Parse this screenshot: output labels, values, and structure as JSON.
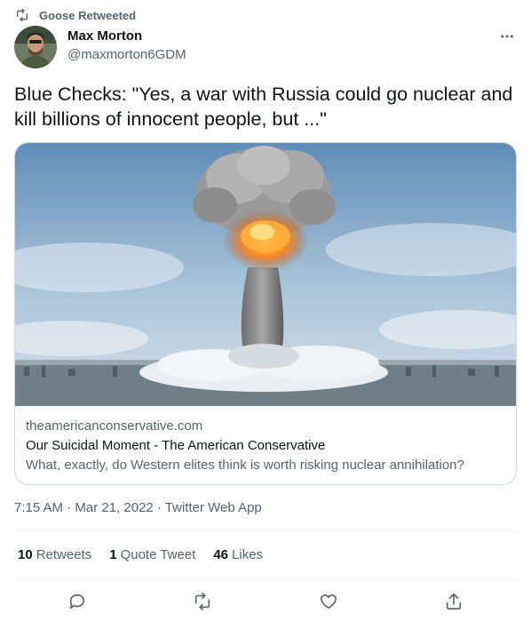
{
  "retweet": {
    "label": "Goose Retweeted",
    "icon": "retweet-icon"
  },
  "author": {
    "name": "Max Morton",
    "handle": "@maxmorton6GDM",
    "avatar_icon": "avatar"
  },
  "tweet": {
    "text": "Blue Checks: \"Yes, a war with Russia could go nuclear and kill billions of innocent people, but ...\""
  },
  "card": {
    "domain": "theamericanconservative.com",
    "title": "Our Suicidal Moment - The American Conservative",
    "description": "What, exactly, do Western elites think is worth risking nuclear annihilation?",
    "image_icon": "mushroom-cloud-image"
  },
  "meta": {
    "timestamp": "7:15 AM · Mar 21, 2022 · Twitter Web App"
  },
  "stats": {
    "retweets_count": "10",
    "retweets_label": "Retweets",
    "quotes_count": "1",
    "quotes_label": "Quote Tweet",
    "likes_count": "46",
    "likes_label": "Likes"
  },
  "actions": [
    "reply-icon",
    "retweet-icon",
    "like-icon",
    "share-icon"
  ],
  "colors": {
    "text": "#0f1419",
    "secondary": "#536471",
    "border": "#cfd9de",
    "divider": "#eff3f4"
  }
}
